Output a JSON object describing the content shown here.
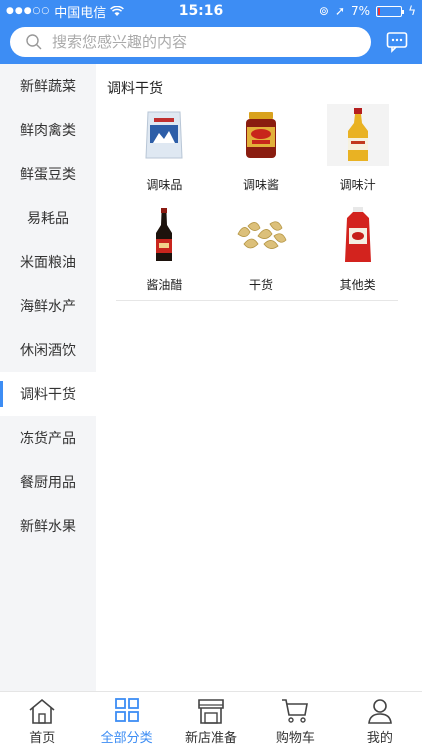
{
  "status": {
    "carrier": "中国电信",
    "time": "15:16",
    "battery": "7%",
    "battery_level": 0.07
  },
  "search": {
    "placeholder": "搜索您感兴趣的内容"
  },
  "sidebar": {
    "items": [
      {
        "label": "新鲜蔬菜"
      },
      {
        "label": "鲜肉禽类"
      },
      {
        "label": "鲜蛋豆类"
      },
      {
        "label": "易耗品"
      },
      {
        "label": "米面粮油"
      },
      {
        "label": "海鲜水产"
      },
      {
        "label": "休闲酒饮"
      },
      {
        "label": "调料干货"
      },
      {
        "label": "冻货产品"
      },
      {
        "label": "餐厨用品"
      },
      {
        "label": "新鲜水果"
      }
    ],
    "active_index": 7
  },
  "main": {
    "title": "调料干货",
    "items": [
      {
        "label": "调味品",
        "icon": "salt-bag-icon"
      },
      {
        "label": "调味酱",
        "icon": "sauce-jar-icon"
      },
      {
        "label": "调味汁",
        "icon": "oil-bottle-icon"
      },
      {
        "label": "酱油醋",
        "icon": "soy-sauce-bottle-icon"
      },
      {
        "label": "干货",
        "icon": "dried-food-icon"
      },
      {
        "label": "其他类",
        "icon": "ketchup-bottle-icon"
      }
    ]
  },
  "tabbar": {
    "items": [
      {
        "label": "首页",
        "icon": "home-icon"
      },
      {
        "label": "全部分类",
        "icon": "grid-icon"
      },
      {
        "label": "新店准备",
        "icon": "store-icon"
      },
      {
        "label": "购物车",
        "icon": "cart-icon"
      },
      {
        "label": "我的",
        "icon": "user-icon"
      }
    ],
    "active_index": 1
  },
  "colors": {
    "accent": "#3d8df4",
    "sidebar_bg": "#f4f5f7"
  }
}
